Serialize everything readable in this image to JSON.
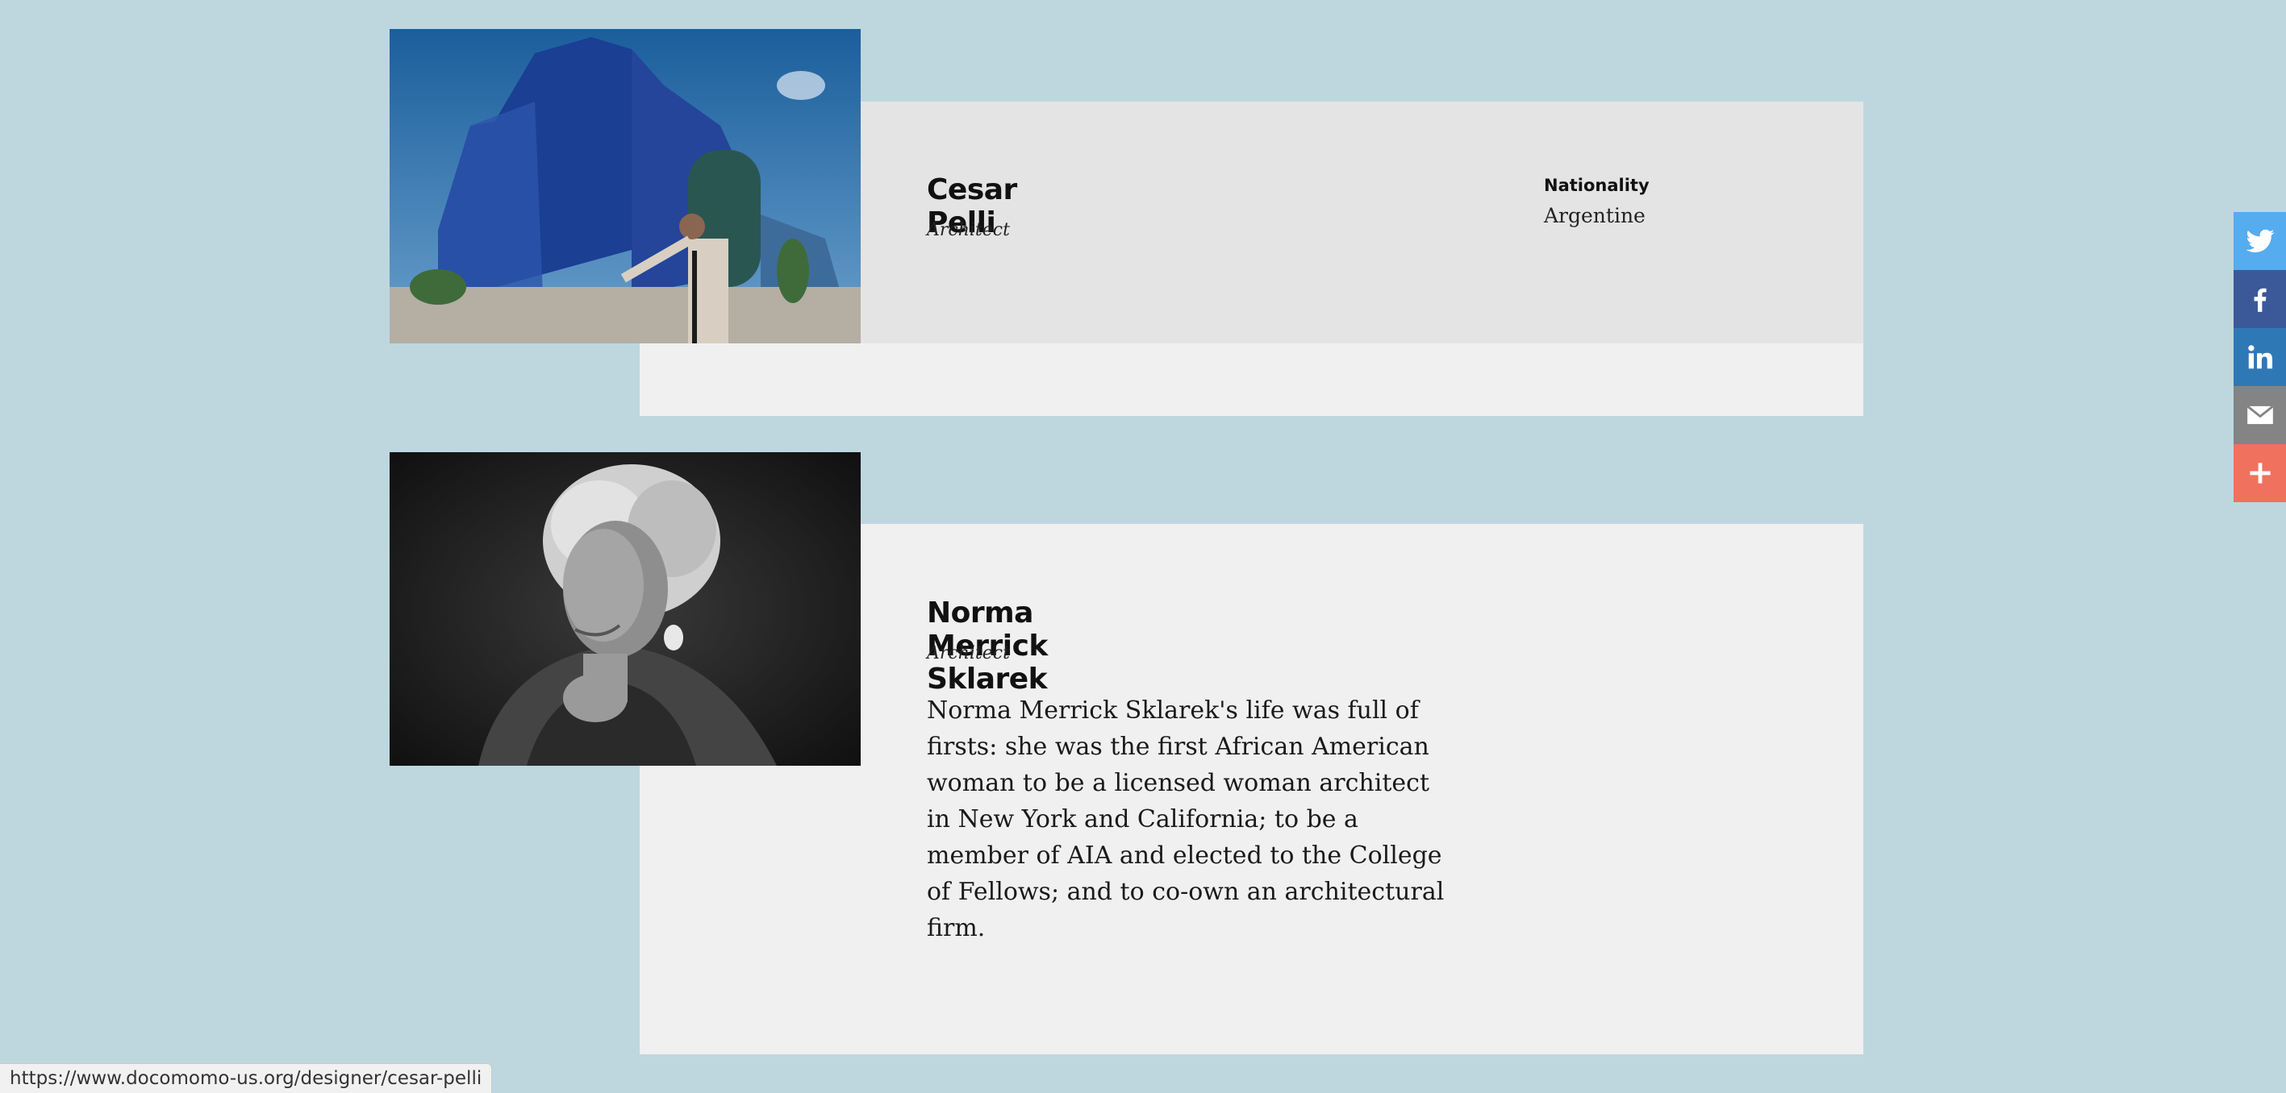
{
  "designers": [
    {
      "name": "Cesar Pelli",
      "role": "Architect",
      "nationality_label": "Nationality",
      "nationality_value": "Argentine",
      "photo": "architect-waving-in-front-of-blue-glass-building"
    },
    {
      "name": "Norma Merrick Sklarek",
      "role": "Architect",
      "bio": "Norma Merrick Sklarek's life was full of firsts: she was the first African American woman to be a licensed woman architect in New York and California; to be a member of AIA and elected to the College of Fellows; and to co-own an architectural firm.",
      "photo": "black-and-white-portrait-of-woman"
    }
  ],
  "share_buttons": [
    {
      "name": "twitter",
      "icon": "twitter-icon",
      "color": "#55acee"
    },
    {
      "name": "facebook",
      "icon": "facebook-icon",
      "color": "#3b5998"
    },
    {
      "name": "linkedin",
      "icon": "linkedin-icon",
      "color": "#2f78b6"
    },
    {
      "name": "email",
      "icon": "email-icon",
      "color": "#848484"
    },
    {
      "name": "more",
      "icon": "plus-icon",
      "color": "#f0715e"
    }
  ],
  "status_bar": {
    "url": "https://www.docomomo-us.org/designer/cesar-pelli"
  },
  "colors": {
    "page_background": "#bed7df",
    "card_background": "#f0f0f0",
    "card_hover_background": "#e4e4e4"
  }
}
